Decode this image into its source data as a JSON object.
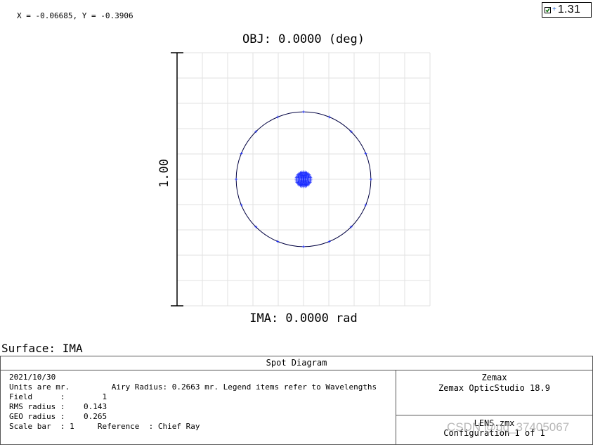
{
  "cursor_readout": "X = -0.06685, Y = -0.3906",
  "zoom": {
    "checked": true,
    "value": "1.31"
  },
  "plot": {
    "title": "OBJ: 0.0000 (deg)",
    "image_label": "IMA: 0.0000 rad",
    "scale_bar_label": "1.00",
    "airy_radius": 0.2663,
    "rms_radius": 0.143,
    "geo_radius": 0.265,
    "scale_bar": 1,
    "spot_color": "#1a2bff",
    "airy_color": "#000040",
    "grid_color": "#e2e2e2"
  },
  "surface_label": "Surface: IMA",
  "table": {
    "title": "Spot Diagram",
    "lines": [
      "2021/10/30",
      "Units are mr.         Airy Radius: 0.2663 mr. Legend items refer to Wavelengths",
      "Field      :        1",
      "RMS radius :    0.143",
      "GEO radius :    0.265",
      "Scale bar  : 1     Reference  : Chief Ray"
    ],
    "company": "Zemax",
    "product": "Zemax OpticStudio 18.9",
    "file": "LENS.zmx",
    "configuration": "Configuration 1 of 1"
  },
  "watermark": "CSDN @qq_37405067"
}
